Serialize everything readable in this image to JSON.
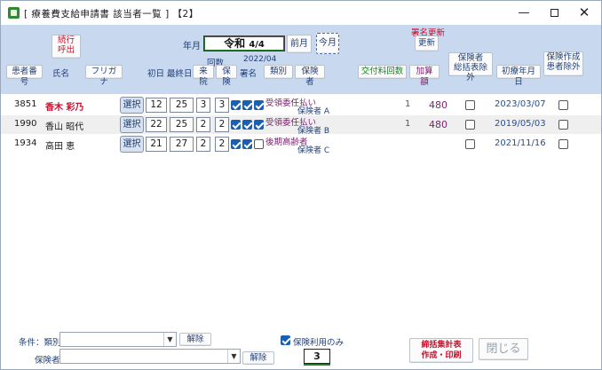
{
  "window": {
    "title": "[ 療養費支給申請書  該当者一覧 ]  【2】",
    "min_glyph": "—",
    "close_glyph": "✕"
  },
  "header": {
    "continue_call_line1": "続行",
    "continue_call_line2": "呼出",
    "year_month_label": "年月",
    "date_era": "令和",
    "date_value": "4/4",
    "prev_month": "前月",
    "this_month": "今月",
    "count_label": "回数",
    "period_label": "2022/04",
    "signature_update_top": "署名更新",
    "signature_update_btn": "更新",
    "insurer_exclude_line1": "保険者",
    "insurer_exclude_line2": "総括表除外",
    "insurance_create_line1": "保険作成",
    "insurance_create_line2": "患者除外",
    "columns": {
      "patient_no": "患者番号",
      "name": "氏名",
      "furigana": "フリガナ",
      "first_day": "初日",
      "last_day": "最終日",
      "visits": "来院",
      "insurance": "保険",
      "signature": "署名",
      "category": "類別",
      "insurer": "保険者",
      "delivery_count": "交付料回数",
      "added_amount": "加算額",
      "first_date": "初療年月日"
    }
  },
  "rows": [
    {
      "patient_no": "3851",
      "name": "香木  彩乃",
      "select": "選択",
      "first_day": "12",
      "last_day": "25",
      "visits": "3",
      "insurance": "3",
      "chk1": true,
      "chk2": true,
      "chk3": true,
      "category_type": "受領委任払い",
      "insurer": "保険者  A",
      "delivery_count": "1",
      "added_amount": "480",
      "first_date": "2023/03/07"
    },
    {
      "patient_no": "1990",
      "name": "香山  昭代",
      "select": "選択",
      "first_day": "22",
      "last_day": "25",
      "visits": "2",
      "insurance": "2",
      "chk1": true,
      "chk2": true,
      "chk3": true,
      "category_type": "受領委任払い",
      "insurer": "保険者  B",
      "delivery_count": "1",
      "added_amount": "480",
      "first_date": "2019/05/03"
    },
    {
      "patient_no": "1934",
      "name": "高田  恵",
      "select": "選択",
      "first_day": "21",
      "last_day": "27",
      "visits": "2",
      "insurance": "2",
      "chk1": true,
      "chk2": true,
      "chk3": false,
      "category_type": "後期高齢者",
      "insurer": "保険者  C",
      "delivery_count": "",
      "added_amount": "",
      "first_date": "2021/11/16"
    }
  ],
  "footer": {
    "condition_label": "条件：類別",
    "insurer_label": "保険者",
    "clear1": "解除",
    "clear2": "解除",
    "insurance_only": "保険利用のみ",
    "count_value": "3",
    "summary_line1": "締括集計表",
    "summary_line2": "作成・印刷",
    "close": "閉じる"
  }
}
